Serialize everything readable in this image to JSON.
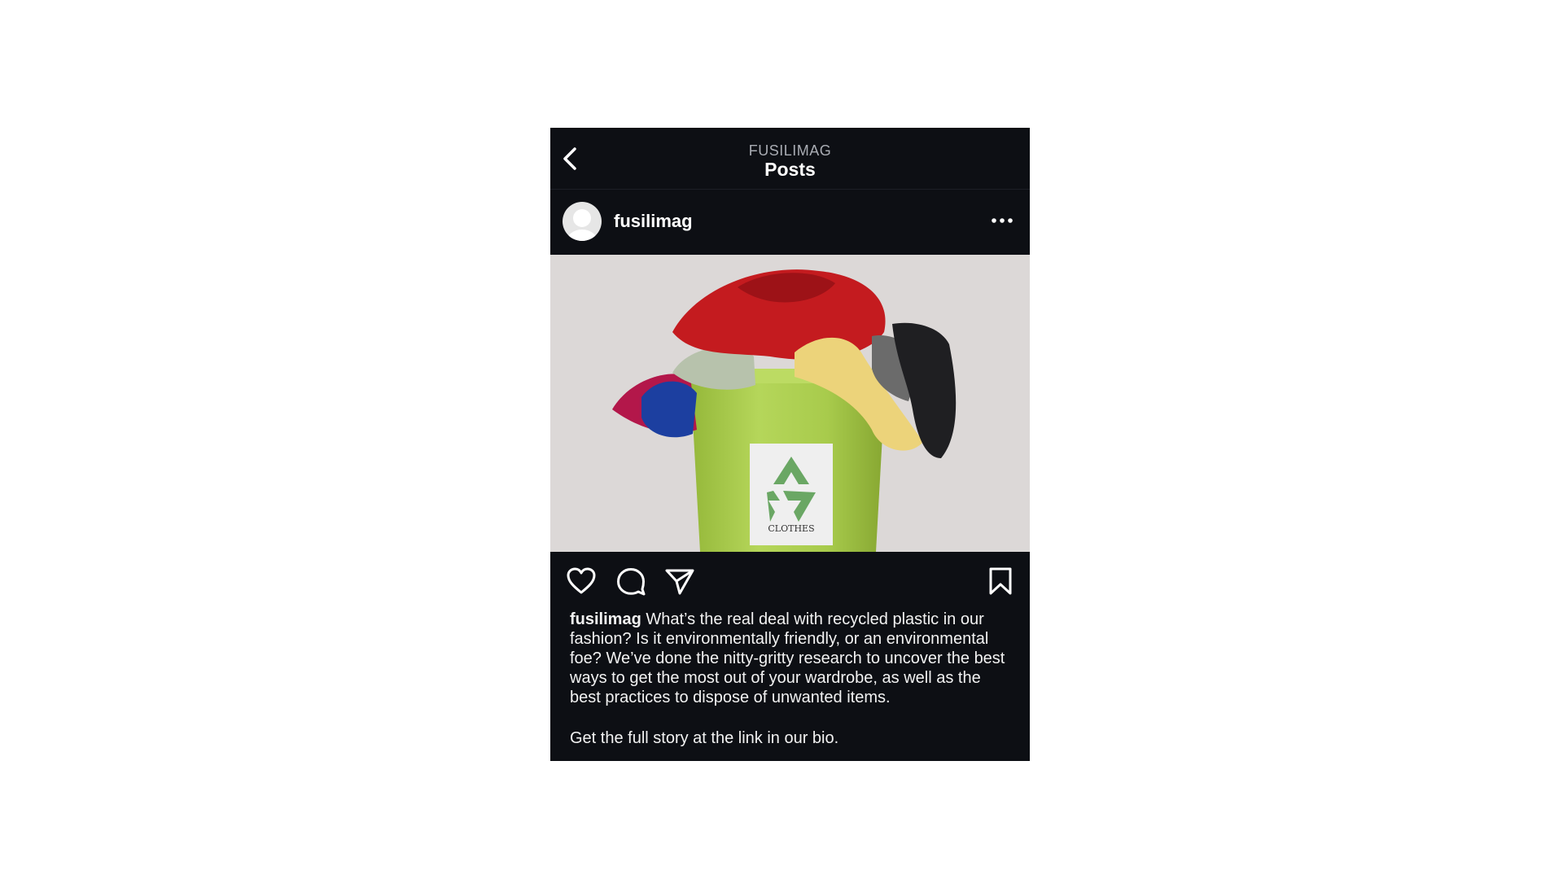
{
  "header": {
    "account_label": "FUSILIMAG",
    "title": "Posts",
    "back_icon": "chevron-left-icon"
  },
  "post": {
    "username": "fusilimag",
    "more_icon": "more-horizontal-icon",
    "image": {
      "bin_label": "CLOTHES",
      "bin_icon": "recycle-icon"
    },
    "actions": {
      "like_icon": "heart-icon",
      "comment_icon": "comment-icon",
      "share_icon": "send-icon",
      "save_icon": "bookmark-icon"
    },
    "caption": {
      "username": "fusilimag",
      "text": " What’s the real deal with recycled plastic in our fashion? Is it environmentally friendly, or an environmental foe? We’ve done the nitty-gritty research to uncover the best ways to get the most out of your wardrobe, as well as the best practices to dispose of unwanted items.",
      "link_line": "Get the full story at the link in our bio."
    }
  },
  "colors": {
    "background": "#0d0f14",
    "text": "#ffffff",
    "muted": "#a9acb3",
    "image_bg": "#dcd8d7",
    "bin": "#a9cc4e",
    "recycle": "#6aa764"
  }
}
